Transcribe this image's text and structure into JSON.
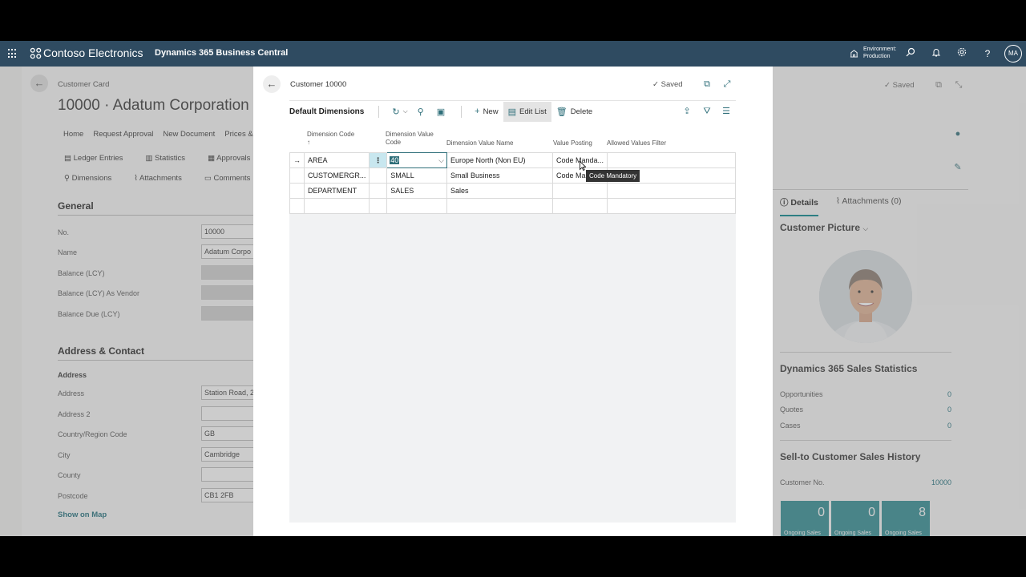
{
  "topbar": {
    "company": "Contoso Electronics",
    "app": "Dynamics 365 Business Central",
    "env_label": "Environment:",
    "env_value": "Production",
    "user_initials": "MA"
  },
  "background": {
    "breadcrumb": "Customer Card",
    "title": "10000 · Adatum Corporation",
    "menu": [
      "Home",
      "Request Approval",
      "New Document",
      "Prices &"
    ],
    "actions_row1": [
      "Ledger Entries",
      "Statistics",
      "Approvals"
    ],
    "actions_row2": [
      "Dimensions",
      "Attachments",
      "Comments"
    ],
    "general_section": "General",
    "general_fields": [
      {
        "label": "No.",
        "value": "10000",
        "readonly": false
      },
      {
        "label": "Name",
        "value": "Adatum Corpo",
        "readonly": false
      },
      {
        "label": "Balance (LCY)",
        "value": "",
        "readonly": true
      },
      {
        "label": "Balance (LCY) As Vendor",
        "value": "",
        "readonly": true
      },
      {
        "label": "Balance Due (LCY)",
        "value": "",
        "readonly": true
      }
    ],
    "address_section": "Address & Contact",
    "address_subheading": "Address",
    "address_fields": [
      {
        "label": "Address",
        "value": "Station Road, 2"
      },
      {
        "label": "Address 2",
        "value": ""
      },
      {
        "label": "Country/Region Code",
        "value": "GB"
      },
      {
        "label": "City",
        "value": "Cambridge"
      },
      {
        "label": "County",
        "value": ""
      },
      {
        "label": "Postcode",
        "value": "CB1 2FB"
      }
    ],
    "show_on_map": "Show on Map",
    "saved": "Saved"
  },
  "factbox": {
    "tab_details": "Details",
    "tab_attachments": "Attachments (0)",
    "customer_picture": "Customer Picture",
    "sales_stats_title": "Dynamics 365 Sales Statistics",
    "sales_stats": [
      {
        "label": "Opportunities",
        "value": "0"
      },
      {
        "label": "Quotes",
        "value": "0"
      },
      {
        "label": "Cases",
        "value": "0"
      }
    ],
    "history_title": "Sell-to Customer Sales History",
    "customer_no_label": "Customer No.",
    "customer_no_value": "10000",
    "tiles": [
      {
        "value": "0",
        "caption": "Ongoing Sales"
      },
      {
        "value": "0",
        "caption": "Ongoing Sales"
      },
      {
        "value": "8",
        "caption": "Ongoing Sales"
      }
    ]
  },
  "modal": {
    "breadcrumb": "Customer 10000",
    "saved": "Saved",
    "page_title": "Default Dimensions",
    "new_label": "New",
    "edit_list_label": "Edit List",
    "delete_label": "Delete",
    "columns": {
      "dimension_code": "Dimension Code",
      "sort_arrow": "↑",
      "dimension_value_code_1": "Dimension Value",
      "dimension_value_code_2": "Code",
      "dimension_value_name": "Dimension Value Name",
      "value_posting": "Value Posting",
      "allowed_values_filter": "Allowed Values Filter"
    },
    "rows": [
      {
        "code": "AREA",
        "value_code": "40",
        "value_name": "Europe North (Non EU)",
        "posting": "Code Manda...",
        "filter": ""
      },
      {
        "code": "CUSTOMERGR...",
        "value_code": "SMALL",
        "value_name": "Small Business",
        "posting": "Code Ma",
        "filter": ""
      },
      {
        "code": "DEPARTMENT",
        "value_code": "SALES",
        "value_name": "Sales",
        "posting": "",
        "filter": ""
      }
    ],
    "tooltip": "Code Mandatory"
  }
}
